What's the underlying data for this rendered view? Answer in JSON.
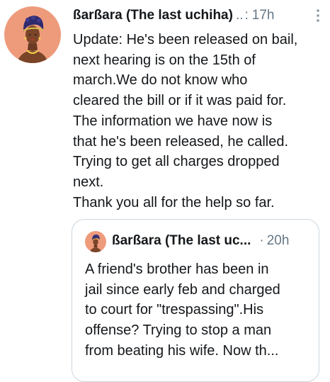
{
  "tweet": {
    "author_name": "ßarßara (The last uchiha)",
    "name_ellipsis": "..",
    "time_separator": ":",
    "timestamp": "17h",
    "more_icon": "vertical-dots-icon",
    "body_lines": [
      "Update: He's been released on bail,",
      "next hearing is on the 15th of",
      "march.We do not know who",
      "cleared the bill or if it was paid for.",
      "The information we have now is",
      "that he's been released, he called.",
      "Trying to get all charges dropped",
      "next.",
      "Thank you all for the help so far."
    ]
  },
  "quoted_tweet": {
    "author_name": "ßarßara (The last uc...",
    "separator": "·",
    "timestamp": "20h",
    "body_lines": [
      "A friend's brother has been in",
      "jail since early feb and charged",
      "to court for \"trespassing\".His",
      "offense? Trying to stop a man",
      "from beating his wife. Now th..."
    ]
  },
  "colors": {
    "avatar_background": "#ee9b7c",
    "text_primary": "#14171a",
    "text_secondary": "#657786",
    "quote_border": "#ccd6dd"
  }
}
